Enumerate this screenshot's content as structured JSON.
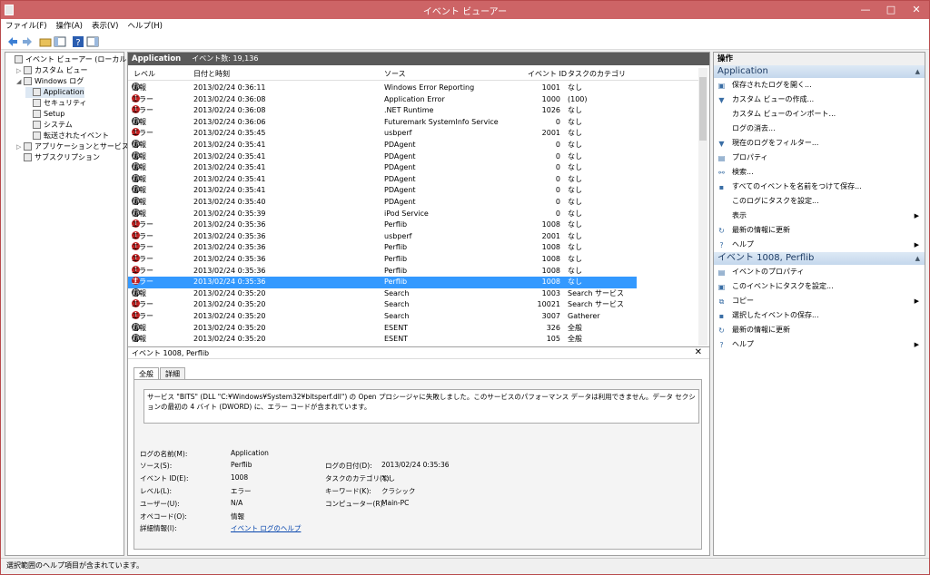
{
  "window": {
    "title": "イベント ビューアー",
    "min": "—",
    "max": "□",
    "close": "✕"
  },
  "menu": [
    "ファイル(F)",
    "操作(A)",
    "表示(V)",
    "ヘルプ(H)"
  ],
  "tree": [
    {
      "label": "イベント ビューアー (ローカル)",
      "indent": 0,
      "arrow": "",
      "sel": false
    },
    {
      "label": "カスタム ビュー",
      "indent": 1,
      "arrow": "▷",
      "sel": false
    },
    {
      "label": "Windows ログ",
      "indent": 1,
      "arrow": "◢",
      "sel": false
    },
    {
      "label": "Application",
      "indent": 2,
      "arrow": "",
      "sel": true
    },
    {
      "label": "セキュリティ",
      "indent": 2,
      "arrow": "",
      "sel": false
    },
    {
      "label": "Setup",
      "indent": 2,
      "arrow": "",
      "sel": false
    },
    {
      "label": "システム",
      "indent": 2,
      "arrow": "",
      "sel": false
    },
    {
      "label": "転送されたイベント",
      "indent": 2,
      "arrow": "",
      "sel": false
    },
    {
      "label": "アプリケーションとサービス ログ",
      "indent": 1,
      "arrow": "▷",
      "sel": false
    },
    {
      "label": "サブスクリプション",
      "indent": 1,
      "arrow": "",
      "sel": false
    }
  ],
  "center": {
    "title": "Application",
    "count": "イベント数: 19,136"
  },
  "columns": {
    "level": "レベル",
    "datetime": "日付と時刻",
    "source": "ソース",
    "id": "イベント ID",
    "task": "タスクのカテゴリ"
  },
  "events": [
    {
      "type": "info",
      "level": "情報",
      "dt": "2013/02/24 0:36:11",
      "src": "Windows Error Reporting",
      "id": "1001",
      "task": "なし"
    },
    {
      "type": "err",
      "level": "エラー",
      "dt": "2013/02/24 0:36:08",
      "src": "Application Error",
      "id": "1000",
      "task": "(100)"
    },
    {
      "type": "err",
      "level": "エラー",
      "dt": "2013/02/24 0:36:08",
      "src": ".NET Runtime",
      "id": "1026",
      "task": "なし"
    },
    {
      "type": "info",
      "level": "情報",
      "dt": "2013/02/24 0:36:06",
      "src": "Futuremark SystemInfo Service",
      "id": "0",
      "task": "なし"
    },
    {
      "type": "err",
      "level": "エラー",
      "dt": "2013/02/24 0:35:45",
      "src": "usbperf",
      "id": "2001",
      "task": "なし"
    },
    {
      "type": "info",
      "level": "情報",
      "dt": "2013/02/24 0:35:41",
      "src": "PDAgent",
      "id": "0",
      "task": "なし"
    },
    {
      "type": "info",
      "level": "情報",
      "dt": "2013/02/24 0:35:41",
      "src": "PDAgent",
      "id": "0",
      "task": "なし"
    },
    {
      "type": "info",
      "level": "情報",
      "dt": "2013/02/24 0:35:41",
      "src": "PDAgent",
      "id": "0",
      "task": "なし"
    },
    {
      "type": "info",
      "level": "情報",
      "dt": "2013/02/24 0:35:41",
      "src": "PDAgent",
      "id": "0",
      "task": "なし"
    },
    {
      "type": "info",
      "level": "情報",
      "dt": "2013/02/24 0:35:41",
      "src": "PDAgent",
      "id": "0",
      "task": "なし"
    },
    {
      "type": "info",
      "level": "情報",
      "dt": "2013/02/24 0:35:40",
      "src": "PDAgent",
      "id": "0",
      "task": "なし"
    },
    {
      "type": "info",
      "level": "情報",
      "dt": "2013/02/24 0:35:39",
      "src": "iPod Service",
      "id": "0",
      "task": "なし"
    },
    {
      "type": "err",
      "level": "エラー",
      "dt": "2013/02/24 0:35:36",
      "src": "Perflib",
      "id": "1008",
      "task": "なし"
    },
    {
      "type": "err",
      "level": "エラー",
      "dt": "2013/02/24 0:35:36",
      "src": "usbperf",
      "id": "2001",
      "task": "なし"
    },
    {
      "type": "err",
      "level": "エラー",
      "dt": "2013/02/24 0:35:36",
      "src": "Perflib",
      "id": "1008",
      "task": "なし"
    },
    {
      "type": "err",
      "level": "エラー",
      "dt": "2013/02/24 0:35:36",
      "src": "Perflib",
      "id": "1008",
      "task": "なし"
    },
    {
      "type": "err",
      "level": "エラー",
      "dt": "2013/02/24 0:35:36",
      "src": "Perflib",
      "id": "1008",
      "task": "なし"
    },
    {
      "type": "err",
      "level": "エラー",
      "dt": "2013/02/24 0:35:36",
      "src": "Perflib",
      "id": "1008",
      "task": "なし",
      "sel": true
    },
    {
      "type": "info",
      "level": "情報",
      "dt": "2013/02/24 0:35:20",
      "src": "Search",
      "id": "1003",
      "task": "Search サービス"
    },
    {
      "type": "err",
      "level": "エラー",
      "dt": "2013/02/24 0:35:20",
      "src": "Search",
      "id": "10021",
      "task": "Search サービス"
    },
    {
      "type": "err",
      "level": "エラー",
      "dt": "2013/02/24 0:35:20",
      "src": "Search",
      "id": "3007",
      "task": "Gatherer"
    },
    {
      "type": "info",
      "level": "情報",
      "dt": "2013/02/24 0:35:20",
      "src": "ESENT",
      "id": "326",
      "task": "全般"
    },
    {
      "type": "info",
      "level": "情報",
      "dt": "2013/02/24 0:35:20",
      "src": "ESENT",
      "id": "105",
      "task": "全般"
    }
  ],
  "detail": {
    "title": "イベント 1008, Perflib",
    "tab_general": "全般",
    "tab_detail": "詳細",
    "description": "サービス \"BITS\" (DLL \"C:¥Windows¥System32¥bitsperf.dll\") の Open プロシージャに失敗しました。このサービスのパフォーマンス データは利用できません。データ セクションの最初の 4 バイト (DWORD) に、エラー コードが含まれています。",
    "log_name_label": "ログの名前(M):",
    "log_name": "Application",
    "source_label": "ソース(S):",
    "source": "Perflib",
    "logged_label": "ログの日付(D):",
    "logged": "2013/02/24 0:35:36",
    "event_id_label": "イベント ID(E):",
    "event_id": "1008",
    "task_label": "タスクのカテゴリ(Y):",
    "task": "なし",
    "level_label": "レベル(L):",
    "level": "エラー",
    "keyword_label": "キーワード(K):",
    "keyword": "クラシック",
    "user_label": "ユーザー(U):",
    "user": "N/A",
    "computer_label": "コンピューター(R):",
    "computer": "Main-PC",
    "opcode_label": "オペコード(O):",
    "opcode": "情報",
    "more_label": "詳細情報(I):",
    "more_link": "イベント ログのヘルプ"
  },
  "actions": {
    "header": "操作",
    "sec1": "Application",
    "items1": [
      {
        "label": "保存されたログを開く...",
        "icon": "open-folder-icon",
        "g": "▣",
        "sub": ""
      },
      {
        "label": "カスタム ビューの作成...",
        "icon": "filter-icon",
        "g": "▼",
        "sub": ""
      },
      {
        "label": "カスタム ビューのインポート...",
        "icon": "",
        "g": "",
        "sub": ""
      },
      {
        "label": "ログの消去...",
        "icon": "",
        "g": "",
        "sub": ""
      },
      {
        "label": "現在のログをフィルター...",
        "icon": "filter-icon",
        "g": "▼",
        "sub": ""
      },
      {
        "label": "プロパティ",
        "icon": "properties-icon",
        "g": "▤",
        "sub": ""
      },
      {
        "label": "検索...",
        "icon": "find-icon",
        "g": "⚯",
        "sub": ""
      },
      {
        "label": "すべてのイベントを名前をつけて保存...",
        "icon": "save-icon",
        "g": "▪",
        "sub": ""
      },
      {
        "label": "このログにタスクを設定...",
        "icon": "",
        "g": "",
        "sub": ""
      },
      {
        "label": "表示",
        "icon": "",
        "g": "",
        "sub": "▶"
      },
      {
        "label": "最新の情報に更新",
        "icon": "refresh-icon",
        "g": "↻",
        "sub": ""
      },
      {
        "label": "ヘルプ",
        "icon": "help-icon",
        "g": "?",
        "sub": "▶"
      }
    ],
    "sec2": "イベント 1008, Perflib",
    "items2": [
      {
        "label": "イベントのプロパティ",
        "icon": "properties-icon",
        "g": "▤",
        "sub": ""
      },
      {
        "label": "このイベントにタスクを設定...",
        "icon": "task-icon",
        "g": "▣",
        "sub": ""
      },
      {
        "label": "コピー",
        "icon": "copy-icon",
        "g": "⧉",
        "sub": "▶"
      },
      {
        "label": "選択したイベントの保存...",
        "icon": "save-icon",
        "g": "▪",
        "sub": ""
      },
      {
        "label": "最新の情報に更新",
        "icon": "refresh-icon",
        "g": "↻",
        "sub": ""
      },
      {
        "label": "ヘルプ",
        "icon": "help-icon",
        "g": "?",
        "sub": "▶"
      }
    ]
  },
  "status": "選択範囲のヘルプ項目が含まれています。"
}
